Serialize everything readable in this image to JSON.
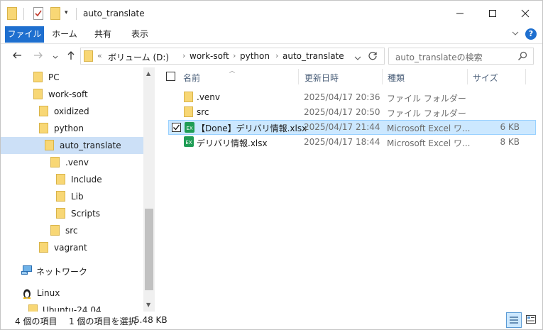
{
  "window": {
    "title": "auto_translate",
    "quick_access_dropdown": "▾"
  },
  "ribbon": {
    "tabs": [
      "ファイル",
      "ホーム",
      "共有",
      "表示"
    ],
    "help_label": "?"
  },
  "address": {
    "prefix": "«",
    "crumbs": [
      "ボリューム (D:)",
      "work-soft",
      "python",
      "auto_translate"
    ],
    "separator": "›"
  },
  "search": {
    "placeholder": "auto_translateの検索"
  },
  "nav": {
    "items": [
      {
        "label": "PC"
      },
      {
        "label": "work-soft"
      },
      {
        "label": "oxidized"
      },
      {
        "label": "python"
      },
      {
        "label": "auto_translate",
        "selected": true
      },
      {
        "label": ".venv"
      },
      {
        "label": "Include"
      },
      {
        "label": "Lib"
      },
      {
        "label": "Scripts"
      },
      {
        "label": "src"
      },
      {
        "label": "vagrant"
      },
      {
        "label": "ネットワーク"
      },
      {
        "label": "Linux"
      },
      {
        "label": "Ubuntu-24.04"
      }
    ]
  },
  "list": {
    "columns": {
      "name": "名前",
      "date": "更新日時",
      "type": "種類",
      "size": "サイズ"
    },
    "rows": [
      {
        "name": ".venv",
        "date": "2025/04/17 20:36",
        "type": "ファイル フォルダー",
        "size": "",
        "icon": "folder-icon",
        "selected": false
      },
      {
        "name": "src",
        "date": "2025/04/17 20:50",
        "type": "ファイル フォルダー",
        "size": "",
        "icon": "folder-icon",
        "selected": false
      },
      {
        "name": "【Done】デリバリ情報.xlsx",
        "date": "2025/04/17 21:44",
        "type": "Microsoft Excel ワ...",
        "size": "6 KB",
        "icon": "excel-file-icon",
        "selected": true
      },
      {
        "name": "デリバリ情報.xlsx",
        "date": "2025/04/17 18:44",
        "type": "Microsoft Excel ワ...",
        "size": "8 KB",
        "icon": "excel-file-icon",
        "selected": false
      }
    ]
  },
  "status": {
    "count": "4 個の項目",
    "selection": "1 個の項目を選択",
    "size": "5.48 KB"
  },
  "colors": {
    "accent": "#1e6fcf",
    "selection": "#cce8ff",
    "folder": "#f8d775",
    "excel": "#1f9d55"
  }
}
